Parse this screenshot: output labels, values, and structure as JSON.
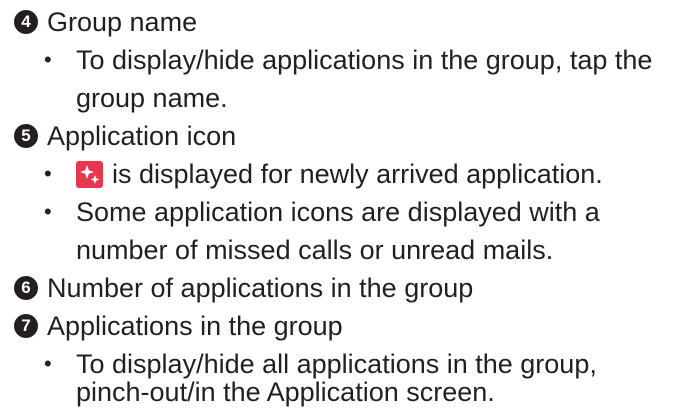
{
  "items": [
    {
      "number": "4",
      "title": "Group name",
      "bullets": [
        {
          "lines": [
            "To display/hide applications in the group, tap the",
            "group name."
          ]
        }
      ]
    },
    {
      "number": "5",
      "title": "Application icon",
      "bullets": [
        {
          "icon": "new-arrival-sparkle-icon",
          "lines": [
            "is displayed for newly arrived application."
          ]
        },
        {
          "lines": [
            "Some application icons are displayed with a",
            "number of missed calls or unread mails."
          ]
        }
      ]
    },
    {
      "number": "6",
      "title": "Number of applications in the group"
    },
    {
      "number": "7",
      "title": "Applications in the group",
      "bullets": [
        {
          "lines": [
            "To display/hide all applications in the group,",
            "pinch-out/in the Application screen."
          ]
        }
      ]
    }
  ],
  "colors": {
    "text": "#231f20",
    "badge": "#231f20",
    "icon_background": "#e8364f"
  }
}
